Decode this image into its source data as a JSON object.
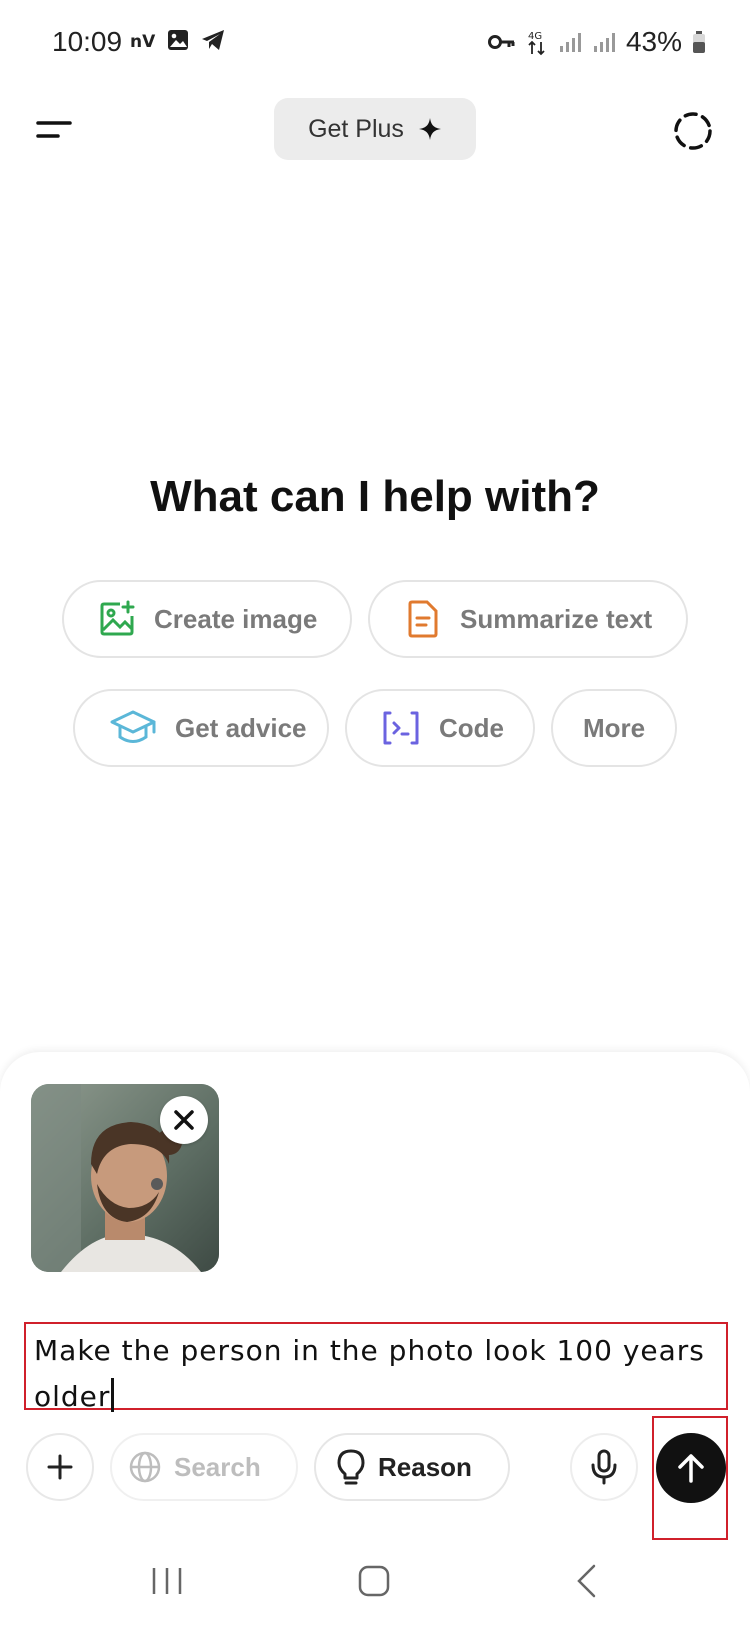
{
  "status_bar": {
    "time": "10:09",
    "battery_percent": "43%",
    "left_icons": [
      "nv-app-icon",
      "gallery-icon",
      "telegram-icon"
    ],
    "right_icons": [
      "key-icon",
      "4g-data-icon",
      "signal-icon",
      "signal-icon",
      "battery-icon"
    ]
  },
  "header": {
    "get_plus_label": "Get Plus"
  },
  "main": {
    "headline": "What can I help with?",
    "suggestions": [
      {
        "label": "Create image",
        "icon": "image-plus-icon",
        "color": "#2fa84f"
      },
      {
        "label": "Summarize text",
        "icon": "document-icon",
        "color": "#e07a2f"
      },
      {
        "label": "Get advice",
        "icon": "graduation-cap-icon",
        "color": "#5bb7d8"
      },
      {
        "label": "Code",
        "icon": "code-icon",
        "color": "#6b63e0"
      },
      {
        "label": "More",
        "icon": "",
        "color": ""
      }
    ]
  },
  "composer": {
    "prompt_text": "Make the person in the photo look 100 years older",
    "search_label": "Search",
    "reason_label": "Reason"
  },
  "colors": {
    "accent_highlight": "#d0202b",
    "send_button": "#111111"
  }
}
